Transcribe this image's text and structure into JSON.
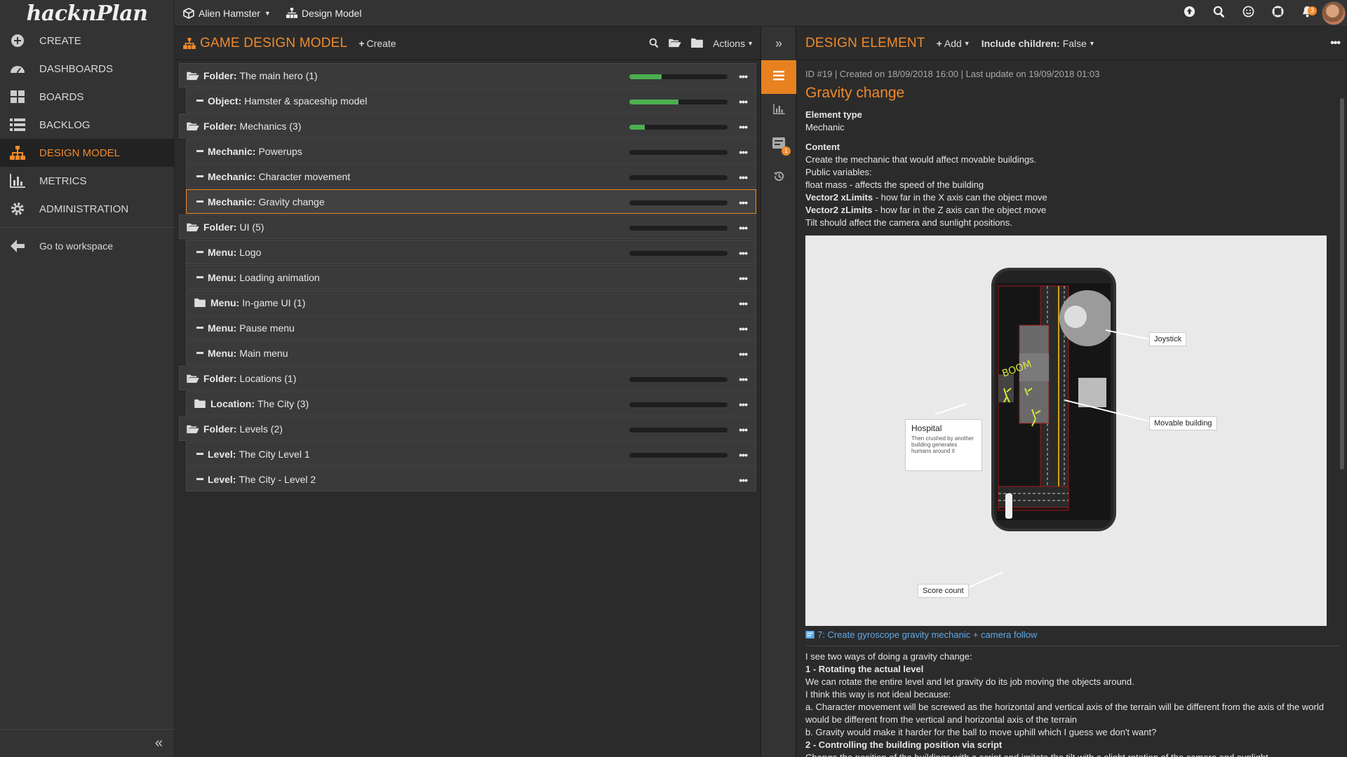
{
  "logo": "hacknPlan",
  "sidebar": {
    "items": [
      {
        "label": "CREATE",
        "icon": "plus-circle-icon"
      },
      {
        "label": "DASHBOARDS",
        "icon": "dashboard-gauge-icon"
      },
      {
        "label": "BOARDS",
        "icon": "boards-grid-icon"
      },
      {
        "label": "BACKLOG",
        "icon": "list-icon"
      },
      {
        "label": "DESIGN MODEL",
        "icon": "sitemap-icon"
      },
      {
        "label": "METRICS",
        "icon": "bar-chart-icon"
      },
      {
        "label": "ADMINISTRATION",
        "icon": "gear-icon"
      }
    ],
    "workspace_link": "Go to workspace",
    "collapse_icon": "double-chevron-left-icon"
  },
  "topbar": {
    "project": "Alien Hamster",
    "section": "Design Model",
    "notifications_count": "3"
  },
  "middle": {
    "title": "GAME DESIGN MODEL",
    "create_label": "Create",
    "actions_label": "Actions",
    "rows": [
      {
        "type": "Folder:",
        "name": "The main hero (1)",
        "level": 0,
        "icon": "folder-open",
        "progress": 0.33
      },
      {
        "type": "Object:",
        "name": "Hamster & spaceship model",
        "level": 1,
        "icon": "dash",
        "progress": 0.5
      },
      {
        "type": "Folder:",
        "name": "Mechanics (3)",
        "level": 0,
        "icon": "folder-open",
        "progress": 0.16
      },
      {
        "type": "Mechanic:",
        "name": "Powerups",
        "level": 1,
        "icon": "dash",
        "progress": 0
      },
      {
        "type": "Mechanic:",
        "name": "Character movement",
        "level": 1,
        "icon": "dash",
        "progress": 0
      },
      {
        "type": "Mechanic:",
        "name": "Gravity change",
        "level": 1,
        "icon": "dash",
        "progress": 0,
        "selected": true
      },
      {
        "type": "Folder:",
        "name": "UI (5)",
        "level": 0,
        "icon": "folder-open",
        "progress": 0
      },
      {
        "type": "Menu:",
        "name": "Logo",
        "level": 1,
        "icon": "dash",
        "progress": 0
      },
      {
        "type": "Menu:",
        "name": "Loading animation",
        "level": 1,
        "icon": "dash",
        "progress": null
      },
      {
        "type": "Menu:",
        "name": "In-game UI (1)",
        "level": 1,
        "icon": "folder",
        "progress": null
      },
      {
        "type": "Menu:",
        "name": "Pause menu",
        "level": 1,
        "icon": "dash",
        "progress": null
      },
      {
        "type": "Menu:",
        "name": "Main menu",
        "level": 1,
        "icon": "dash",
        "progress": null
      },
      {
        "type": "Folder:",
        "name": "Locations (1)",
        "level": 0,
        "icon": "folder-open",
        "progress": 0
      },
      {
        "type": "Location:",
        "name": "The City (3)",
        "level": 1,
        "icon": "folder",
        "progress": 0
      },
      {
        "type": "Folder:",
        "name": "Levels (2)",
        "level": 0,
        "icon": "folder-open",
        "progress": 0
      },
      {
        "type": "Level:",
        "name": "The City Level 1",
        "level": 1,
        "icon": "dash",
        "progress": 0
      },
      {
        "type": "Level:",
        "name": "The City - Level 2",
        "level": 1,
        "icon": "dash",
        "progress": null
      }
    ]
  },
  "right": {
    "title": "DESIGN ELEMENT",
    "add_label": "Add",
    "include_children_label": "Include children:",
    "include_children_value": "False",
    "meta": "ID #19 | Created on 18/09/2018 16:00 | Last update on 19/09/2018 01:03",
    "element_title": "Gravity change",
    "element_type_label": "Element type",
    "element_type_value": "Mechanic",
    "content_label": "Content",
    "content_line1": "Create the mechanic that would affect movable buildings.",
    "content_line2": "Public variables:",
    "content_line3": "float mass - affects the speed of the building",
    "content_line4_bold": "Vector2 xLimits",
    "content_line4_rest": " - how far in the X axis can the object move",
    "content_line5_bold": "Vector2 zLimits",
    "content_line5_rest": " - how far in the Z axis can the object move",
    "content_line6": "Tilt should affect the camera and sunlight positions.",
    "image_callouts": {
      "joystick": "Joystick",
      "movable_building": "Movable building",
      "hospital_title": "Hospital",
      "hospital_text": "Then crushed by another building generates humans around it",
      "score_count": "Score count",
      "boom": "BOOM"
    },
    "task_link": "7: Create gyroscope gravity mechanic + camera follow",
    "body": [
      {
        "text": "I see two ways of doing a gravity change:",
        "bold": false
      },
      {
        "text": "1 - Rotating the actual level",
        "bold": true
      },
      {
        "text": "We can rotate the entire level and let gravity do its job moving the objects around.",
        "bold": false
      },
      {
        "text": "I think this way is not ideal because:",
        "bold": false
      },
      {
        "text": "a. Character movement will be screwed as the horizontal and vertical axis of the terrain will be different from the axis of the world would be different from the vertical and horizontal axis of the terrain",
        "bold": false
      },
      {
        "text": "b. Gravity would make it harder for the ball to move uphill which I guess we don't want?",
        "bold": false
      },
      {
        "text": "2 - Controlling the building position via script",
        "bold": true
      },
      {
        "text": "Change the position of the buildings with a script and imitate the tilt with a slight rotation of the camera and sunlight.",
        "bold": false
      }
    ]
  },
  "colors": {
    "accent": "#f08a2b",
    "progress": "#4caf50",
    "link": "#5fa9e8"
  }
}
